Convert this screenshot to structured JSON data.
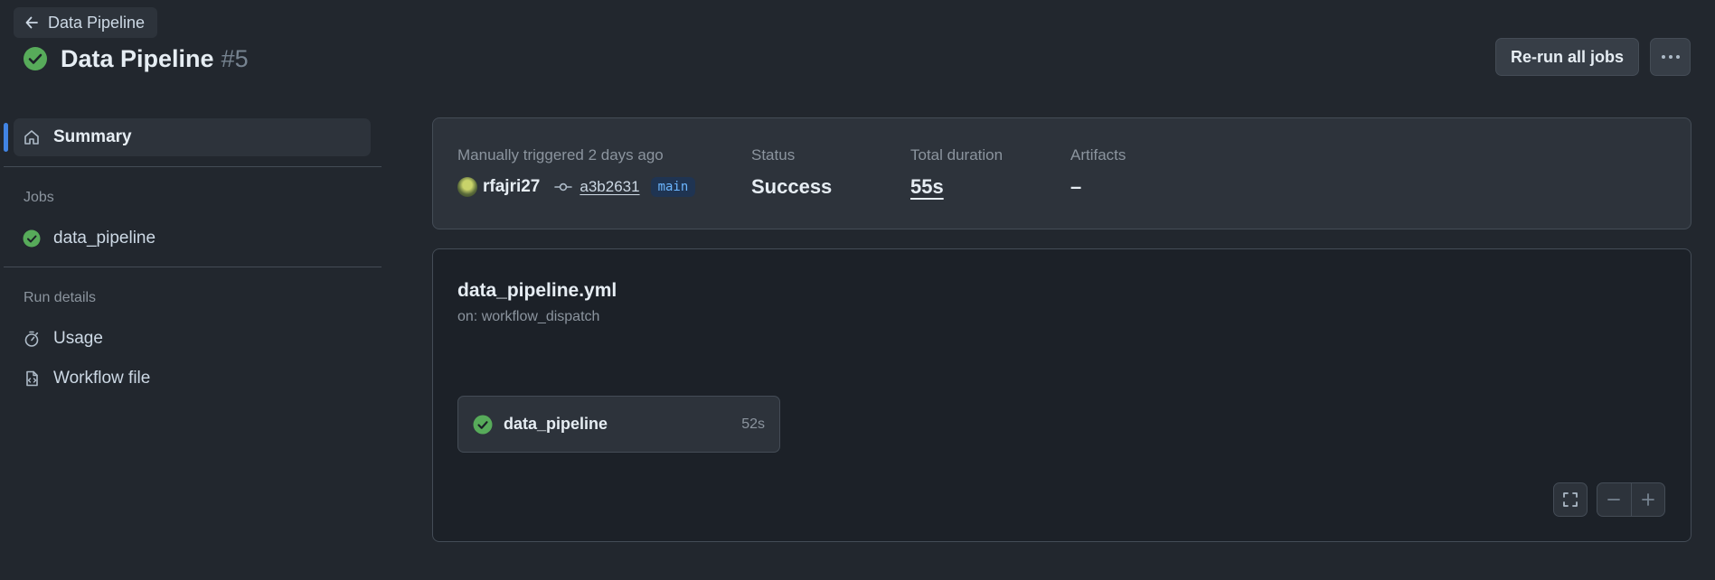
{
  "header": {
    "back_label": "Data Pipeline",
    "title": "Data Pipeline",
    "run_number": "#5",
    "rerun_label": "Re-run all jobs",
    "more_icon": "kebab-horizontal-icon"
  },
  "sidebar": {
    "summary_label": "Summary",
    "jobs_heading": "Jobs",
    "jobs": [
      {
        "label": "data_pipeline",
        "status": "success"
      }
    ],
    "run_details_heading": "Run details",
    "usage_label": "Usage",
    "workflow_file_label": "Workflow file"
  },
  "summary": {
    "trigger_text": "Manually triggered 2 days ago",
    "actor": "rfajri27",
    "commit_sha": "a3b2631",
    "branch": "main",
    "status_label": "Status",
    "status_value": "Success",
    "duration_label": "Total duration",
    "duration_value": "55s",
    "artifacts_label": "Artifacts",
    "artifacts_value": "–"
  },
  "workflow": {
    "file_name": "data_pipeline.yml",
    "trigger": "on: workflow_dispatch",
    "job": {
      "name": "data_pipeline",
      "duration": "52s"
    }
  },
  "colors": {
    "success": "#57ab5a",
    "accent": "#4184e4",
    "background": "#22272e"
  }
}
